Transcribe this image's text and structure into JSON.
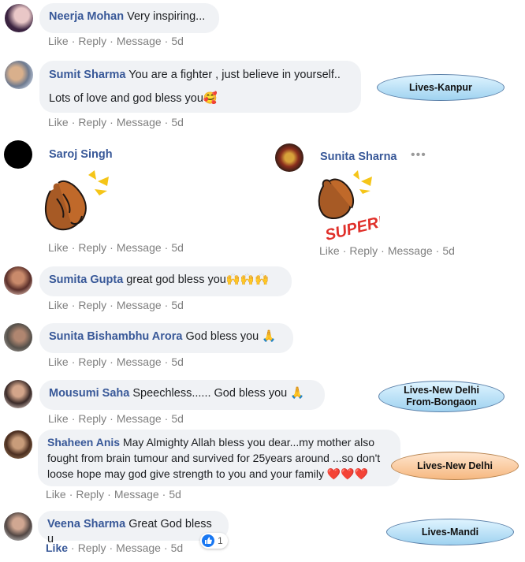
{
  "actions": {
    "like": "Like",
    "reply": "Reply",
    "message": "Message",
    "sep": "·"
  },
  "comments": [
    {
      "author": "Neerja Mohan",
      "text": "Very inspiring...",
      "time": "5d"
    },
    {
      "author": "Sumit Sharma",
      "text_line1": "You are a fighter , just believe in yourself..",
      "text_line2": "Lots of love and god bless you🥰",
      "time": "5d"
    },
    {
      "author": "Saroj Singh",
      "time": "5d"
    },
    {
      "author": "Sunita Sharna",
      "time": "5d",
      "sticker_text": "SUPER!"
    },
    {
      "author": "Sumita Gupta",
      "text": "great god bless you🙌🙌🙌",
      "time": "5d"
    },
    {
      "author": "Sunita Bishambhu Arora",
      "text": "God bless you 🙏",
      "time": "5d"
    },
    {
      "author": "Mousumi Saha",
      "text": "Speechless...... God bless you 🙏",
      "time": "5d"
    },
    {
      "author": "Shaheen Anis",
      "text_line1": "May Almighty Allah bless you dear...my mother also",
      "text_line2": "fought from brain tumour and survived for 25years around ...so don't",
      "text_line3": "loose hope may god give strength to you and your family ❤️❤️❤️",
      "time": "5d"
    },
    {
      "author": "Veena Sharma",
      "text": "Great God bless u",
      "time": "5d",
      "reactions": "1"
    }
  ],
  "tags": {
    "kanpur": "Lives-Kanpur",
    "delhi_bongaon_l1": "Lives-New Delhi",
    "delhi_bongaon_l2": "From-Bongaon",
    "delhi": "Lives-New Delhi",
    "mandi": "Lives-Mandi"
  },
  "colors": {
    "author": "#385898",
    "bubble": "#f0f2f5",
    "meta": "#7f7f7f",
    "tag_blue": "#b8e2f7",
    "tag_orange": "#f8c79c"
  },
  "icons": [
    "like-reaction-icon",
    "more-options-icon",
    "clap-sticker-icon"
  ]
}
